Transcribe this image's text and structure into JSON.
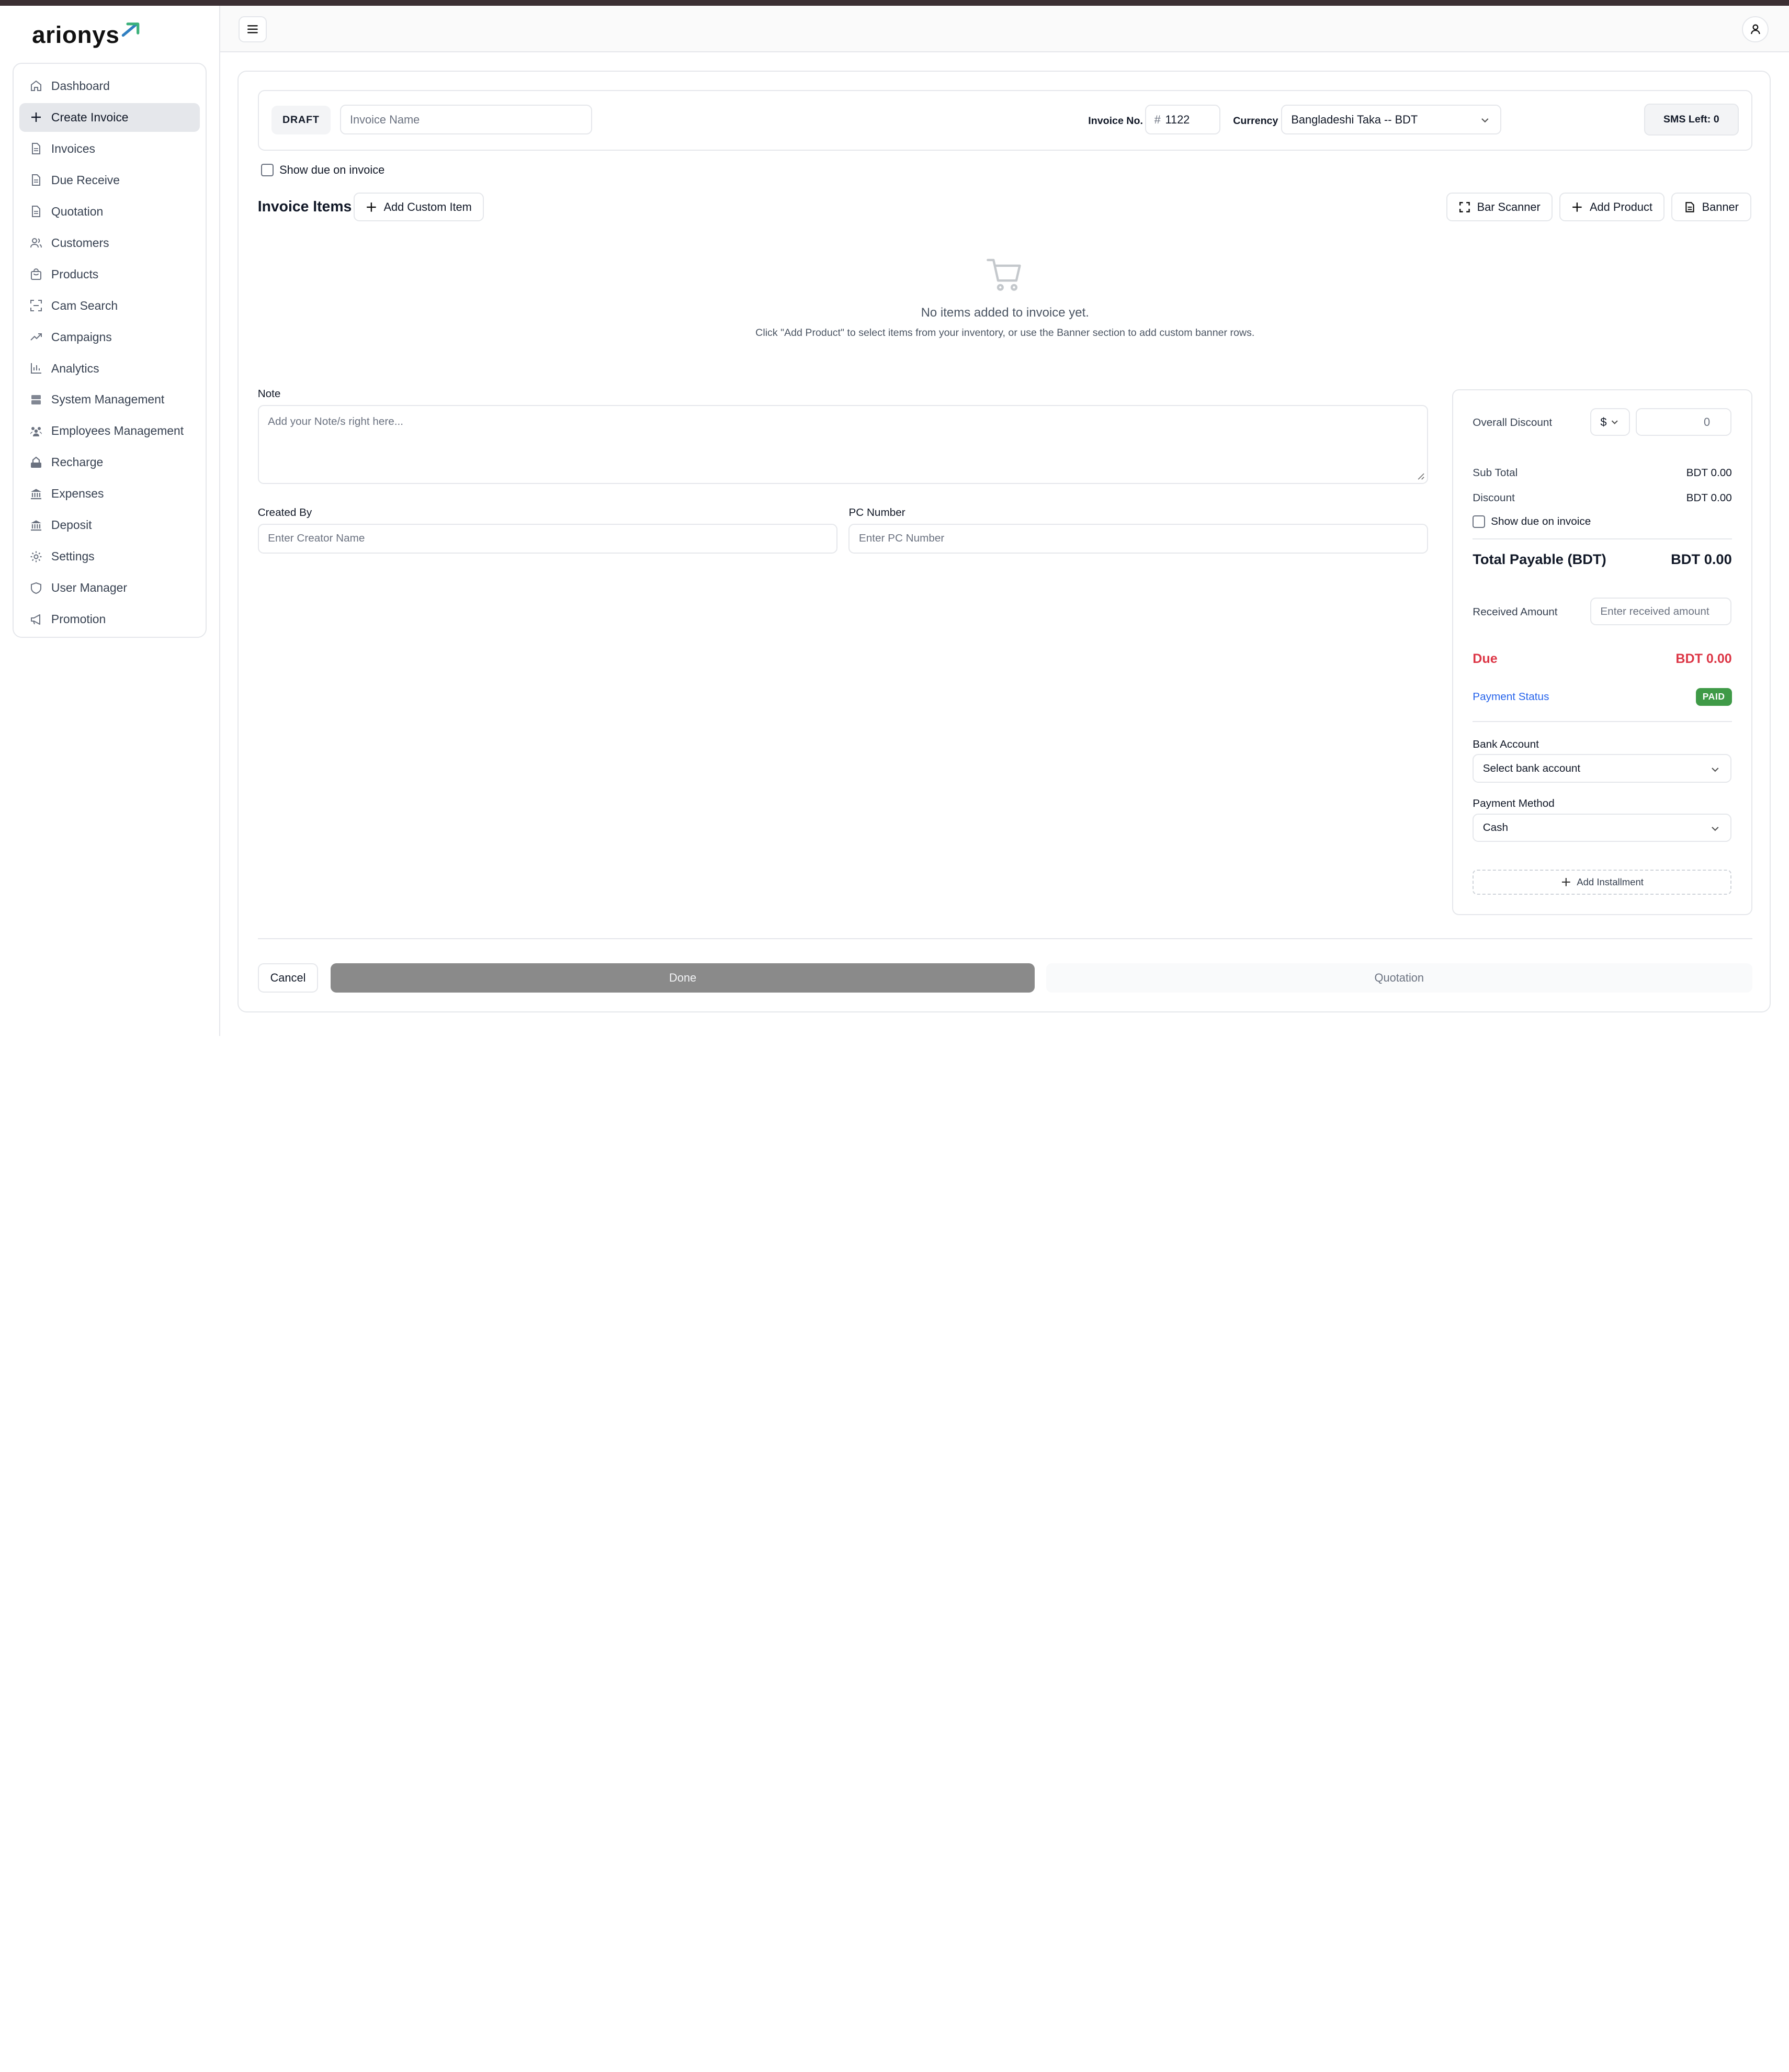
{
  "brand": {
    "logo_text": "arionys",
    "accent": "#3b2f33"
  },
  "sidebar": {
    "items": [
      {
        "label": "Dashboard",
        "icon": "home-icon"
      },
      {
        "label": "Create Invoice",
        "icon": "plus-icon",
        "active": true
      },
      {
        "label": "Invoices",
        "icon": "file-icon"
      },
      {
        "label": "Due Receive",
        "icon": "file-icon"
      },
      {
        "label": "Quotation",
        "icon": "file-icon"
      },
      {
        "label": "Customers",
        "icon": "users-icon"
      },
      {
        "label": "Products",
        "icon": "bag-icon"
      },
      {
        "label": "Cam Search",
        "icon": "scan-icon"
      },
      {
        "label": "Campaigns",
        "icon": "trend-icon"
      },
      {
        "label": "Analytics",
        "icon": "bar-chart-icon"
      },
      {
        "label": "System Management",
        "icon": "server-icon"
      },
      {
        "label": "Employees Management",
        "icon": "team-icon"
      },
      {
        "label": "Recharge",
        "icon": "recharge-icon"
      },
      {
        "label": "Expenses",
        "icon": "bank-icon"
      },
      {
        "label": "Deposit",
        "icon": "bank-icon"
      },
      {
        "label": "Settings",
        "icon": "gear-icon"
      },
      {
        "label": "User Manager",
        "icon": "shield-icon"
      },
      {
        "label": "Promotion",
        "icon": "megaphone-icon"
      }
    ]
  },
  "header": {
    "menu_icon": "hamburger-icon",
    "user_icon": "user-icon"
  },
  "invoice_header": {
    "status_badge": "DRAFT",
    "name_placeholder": "Invoice Name",
    "invoice_no_label": "Invoice No.",
    "invoice_no_prefix": "#",
    "invoice_no_value": "1122",
    "currency_label": "Currency",
    "currency_value": "Bangladeshi Taka -- BDT",
    "sms_left": "SMS Left: 0"
  },
  "show_due_label": "Show due on invoice",
  "items_section": {
    "title": "Invoice Items",
    "add_custom_label": "Add Custom Item",
    "bar_scanner_label": "Bar Scanner",
    "add_product_label": "Add Product",
    "banner_label": "Banner",
    "empty_title": "No items added to invoice yet.",
    "empty_subtitle": "Click \"Add Product\" to select items from your inventory, or use the Banner section to add custom banner rows."
  },
  "note": {
    "label": "Note",
    "placeholder": "Add your Note/s right here..."
  },
  "created_by": {
    "label": "Created By",
    "placeholder": "Enter Creator Name"
  },
  "pc_number": {
    "label": "PC Number",
    "placeholder": "Enter PC Number"
  },
  "summary": {
    "overall_discount_label": "Overall Discount",
    "discount_type": "$",
    "discount_value": "0",
    "sub_total_label": "Sub Total",
    "sub_total_value": "BDT 0.00",
    "discount_label": "Discount",
    "discount_amount": "BDT 0.00",
    "show_due_label": "Show due on invoice",
    "total_payable_label": "Total Payable (BDT)",
    "total_payable_value": "BDT 0.00",
    "received_label": "Received Amount",
    "received_placeholder": "Enter received amount",
    "due_label": "Due",
    "due_value": "BDT 0.00",
    "due_color": "#dc3545",
    "payment_status_label": "Payment Status",
    "payment_status_value": "PAID",
    "payment_status_color": "#3f9a47",
    "bank_account_label": "Bank Account",
    "bank_account_value": "Select bank account",
    "payment_method_label": "Payment Method",
    "payment_method_value": "Cash",
    "add_installment_label": "Add Installment"
  },
  "actions": {
    "cancel_label": "Cancel",
    "done_label": "Done",
    "quotation_label": "Quotation"
  }
}
